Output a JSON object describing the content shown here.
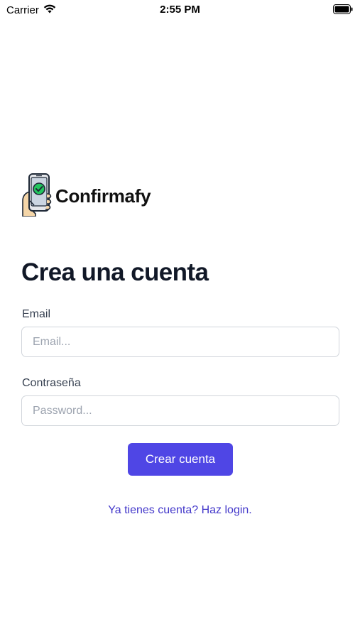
{
  "status_bar": {
    "carrier": "Carrier",
    "time": "2:55 PM",
    "icons": [
      "wifi-icon",
      "battery-icon"
    ]
  },
  "logo": {
    "icon": "phone-check-icon",
    "text": "Confirmafy"
  },
  "form": {
    "title": "Crea una cuenta",
    "email_label": "Email",
    "email_placeholder": "Email...",
    "email_value": "",
    "password_label": "Contraseña",
    "password_placeholder": "Password...",
    "password_value": "",
    "submit_label": "Crear cuenta",
    "login_link": "Ya tienes cuenta? Haz login."
  },
  "colors": {
    "primary": "#4f46e5",
    "link": "#4338ca",
    "border": "#d1d5db",
    "logo_check": "#22c55e"
  }
}
